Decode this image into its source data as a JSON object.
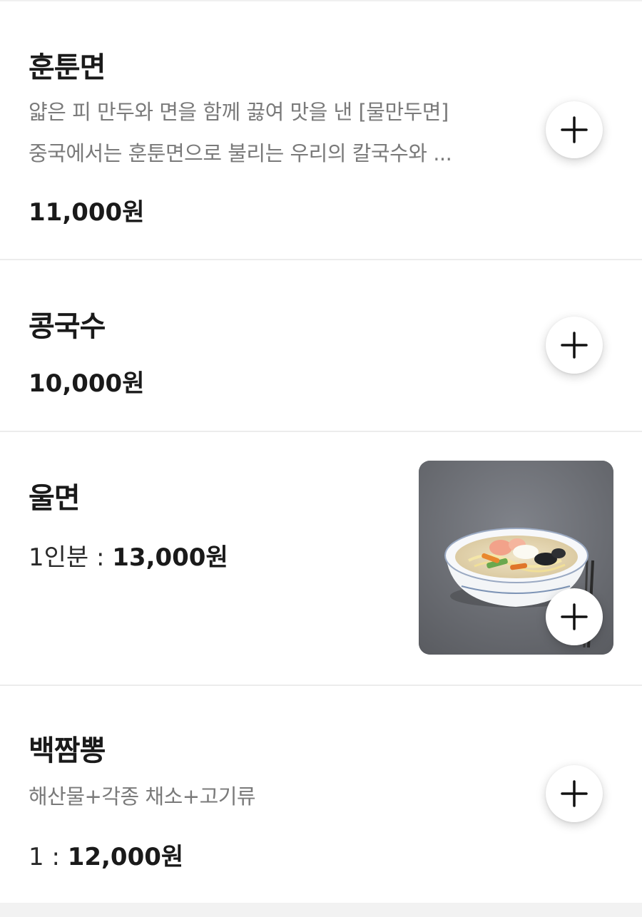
{
  "menu": {
    "items": [
      {
        "name": "훈툰면",
        "desc_line1": "얇은 피 만두와 면을 함께 끓여 맛을 낸 [물만두면]",
        "desc_line2": "중국에서는 훈툰면으로 불리는 우리의 칼국수와 ...",
        "price_prefix": "",
        "price": "11,000원",
        "add_icon": "plus-icon"
      },
      {
        "name": "콩국수",
        "price_prefix": "",
        "price": "10,000원",
        "add_icon": "plus-icon"
      },
      {
        "name": "울면",
        "price_prefix": "1인분 : ",
        "price": "13,000원",
        "image": "noodle-soup-bowl-photo",
        "add_icon": "plus-icon"
      },
      {
        "name": "백짬뽕",
        "desc_line1": "해산물+각종 채소+고기류",
        "price_prefix": "1 : ",
        "price": "12,000원",
        "add_icon": "plus-icon"
      }
    ]
  },
  "colors": {
    "text_primary": "#1a1a1a",
    "text_secondary": "#7a7a7a",
    "divider": "#ececec",
    "button_bg": "#ffffff"
  }
}
